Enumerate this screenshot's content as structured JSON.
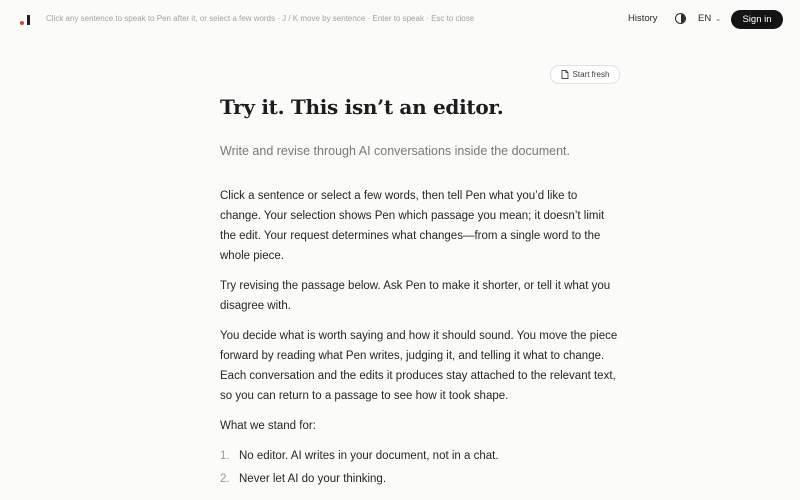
{
  "topbar": {
    "hint": "Click any sentence to speak to Pen after it, or select a few words · J / K move by sentence · Enter to speak · Esc to close",
    "history_label": "History",
    "language": "EN",
    "signin_label": "Sign in"
  },
  "colors": {
    "accent": "#e0452b",
    "primary_button": "#141414"
  },
  "document": {
    "start_fresh_label": "Start fresh",
    "title": "Try it. This isn’t an editor.",
    "subtitle": "Write and revise through AI conversations inside the document.",
    "paragraphs": [
      "Click a sentence or select a few words, then tell Pen what you’d like to change. Your selection shows Pen which passage you mean; it doesn’t limit the edit. Your request determines what changes—from a single word to the whole piece.",
      "Try revising the passage below. Ask Pen to make it shorter, or tell it what you disagree with.",
      "You decide what is worth saying and how it should sound. You move the piece forward by reading what Pen writes, judging it, and telling it what to change. Each conversation and the edits it produces stay attached to the relevant text, so you can return to a passage to see how it took shape.",
      "What we stand for:"
    ],
    "list": [
      {
        "num": "1.",
        "text": "No editor. AI writes in your document, not in a chat."
      },
      {
        "num": "2.",
        "text": "Never let AI do your thinking."
      }
    ]
  }
}
